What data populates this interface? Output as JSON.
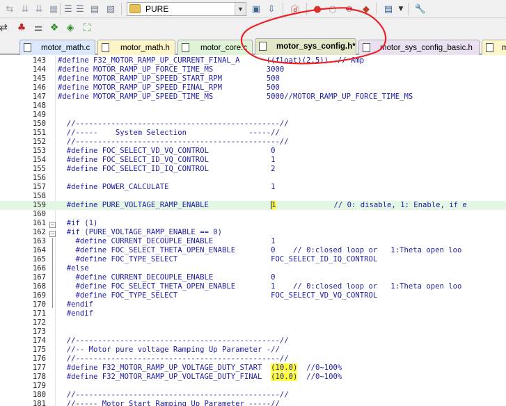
{
  "toolbar": {
    "target_value": "PURE"
  },
  "tabs": [
    {
      "label": "motor_math.c",
      "color": "#dbe8fb",
      "active": false
    },
    {
      "label": "motor_math.h",
      "color": "#fdf5c8",
      "active": false
    },
    {
      "label": "motor_core.c",
      "color": "#dff3d6",
      "active": false
    },
    {
      "label": "motor_sys_config.h*",
      "color": "#e3e6c7",
      "active": true
    },
    {
      "label": "motor_sys_config_basic.h",
      "color": "#ebe0f0",
      "active": false
    },
    {
      "label": "m",
      "color": "#fdf5c8",
      "active": false
    }
  ],
  "editor": {
    "lines": [
      {
        "n": "143",
        "text": "#define F32_MOTOR_RAMP_UP_CURRENT_FINAL_A      ((float)(2.5))  // Amp"
      },
      {
        "n": "144",
        "text": "#define MOTOR_RAMP_UP_FORCE_TIME_MS            3000"
      },
      {
        "n": "145",
        "text": "#define MOTOR_RAMP_UP_SPEED_START_RPM          500"
      },
      {
        "n": "146",
        "text": "#define MOTOR_RAMP_UP_SPEED_FINAL_RPM          500"
      },
      {
        "n": "147",
        "text": "#define MOTOR_RAMP_UP_SPEED_TIME_MS            5000//MOTOR_RAMP_UP_FORCE_TIME_MS"
      },
      {
        "n": "148",
        "text": ""
      },
      {
        "n": "149",
        "text": ""
      },
      {
        "n": "150",
        "text": "  //----------------------------------------------//"
      },
      {
        "n": "151",
        "text": "  //-----    System Selection              -----//"
      },
      {
        "n": "152",
        "text": "  //----------------------------------------------//"
      },
      {
        "n": "153",
        "text": "  #define FOC_SELECT_VD_VQ_CONTROL              0"
      },
      {
        "n": "154",
        "text": "  #define FOC_SELECT_ID_VQ_CONTROL              1"
      },
      {
        "n": "155",
        "text": "  #define FOC_SELECT_ID_IQ_CONTROL              2"
      },
      {
        "n": "156",
        "text": ""
      },
      {
        "n": "157",
        "text": "  #define POWER_CALCULATE                       1"
      },
      {
        "n": "158",
        "text": ""
      },
      {
        "n": "159",
        "text": "  #define PURE_VOLTAGE_RAMP_ENABLE              1             // 0: disable, 1: Enable, if e"
      },
      {
        "n": "160",
        "text": ""
      },
      {
        "n": "161",
        "text": "  #if (1)"
      },
      {
        "n": "162",
        "text": "  #if (PURE_VOLTAGE_RAMP_ENABLE == 0)"
      },
      {
        "n": "163",
        "text": "    #define CURRENT_DECOUPLE_ENABLE             1"
      },
      {
        "n": "164",
        "text": "    #define FOC_SELECT_THETA_OPEN_ENABLE        0    // 0:closed loop or   1:Theta open loo"
      },
      {
        "n": "165",
        "text": "    #define FOC_TYPE_SELECT                     FOC_SELECT_ID_IQ_CONTROL"
      },
      {
        "n": "166",
        "text": "  #else"
      },
      {
        "n": "167",
        "text": "    #define CURRENT_DECOUPLE_ENABLE             0"
      },
      {
        "n": "168",
        "text": "    #define FOC_SELECT_THETA_OPEN_ENABLE        1    // 0:closed loop or   1:Theta open loo"
      },
      {
        "n": "169",
        "text": "    #define FOC_TYPE_SELECT                     FOC_SELECT_VD_VQ_CONTROL"
      },
      {
        "n": "170",
        "text": "  #endif"
      },
      {
        "n": "171",
        "text": "  #endif"
      },
      {
        "n": "172",
        "text": ""
      },
      {
        "n": "173",
        "text": ""
      },
      {
        "n": "174",
        "text": "  //----------------------------------------------//"
      },
      {
        "n": "175",
        "text": "  //-- Motor pure voltage Ramping Up Parameter -//"
      },
      {
        "n": "176",
        "text": "  //----------------------------------------------//"
      },
      {
        "n": "177",
        "text": "  #define F32_MOTOR_RAMP_UP_VOLTAGE_DUTY_START  (10.0)  //0~100%"
      },
      {
        "n": "178",
        "text": "  #define F32_MOTOR_RAMP_UP_VOLTAGE_DUTY_FINAL  (10.0)  //0~100%"
      },
      {
        "n": "179",
        "text": ""
      },
      {
        "n": "180",
        "text": "  //----------------------------------------------//"
      },
      {
        "n": "181",
        "text": "  //----- Motor Start Ramping Up Parameter -----//"
      }
    ]
  }
}
